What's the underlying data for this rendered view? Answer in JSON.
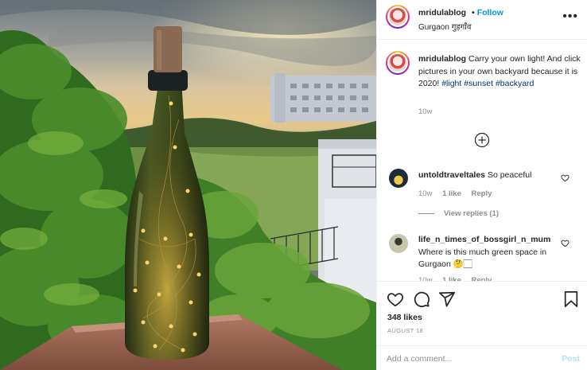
{
  "post": {
    "username": "mridulablog",
    "follow_separator": "•",
    "follow_label": "Follow",
    "location": "Gurgaon गुड़गाँव",
    "more_icon": "more-options-icon",
    "caption_username": "mridulablog",
    "caption_text": "Carry your own light! And click pictures in your own backyard because it is 2020!",
    "hashtags": [
      "#light",
      "#sunset",
      "#backyard"
    ],
    "caption_time": "10w",
    "load_more_icon": "add-circle-icon"
  },
  "comments": [
    {
      "username": "untoldtraveltales",
      "text": "So peaceful",
      "time": "10w",
      "likes": "1 like",
      "reply": "Reply",
      "view_replies": "View replies (1)"
    },
    {
      "username": "life_n_times_of_bossgirl_n_mum",
      "text": "Where is this much green space in Gurgaon 🤔🏻",
      "time": "10w",
      "likes": "1 like",
      "reply": "Reply"
    }
  ],
  "actions": {
    "like_icon": "heart-icon",
    "comment_icon": "comment-icon",
    "share_icon": "share-icon",
    "save_icon": "bookmark-icon",
    "likes_count": "348 likes",
    "date": "AUGUST 18"
  },
  "composer": {
    "placeholder": "Add a comment...",
    "post_label": "Post"
  },
  "colors": {
    "link": "#0095f6",
    "hashtag": "#00376b",
    "muted": "#8e8e8e",
    "post_disabled": "#b2dffc"
  }
}
